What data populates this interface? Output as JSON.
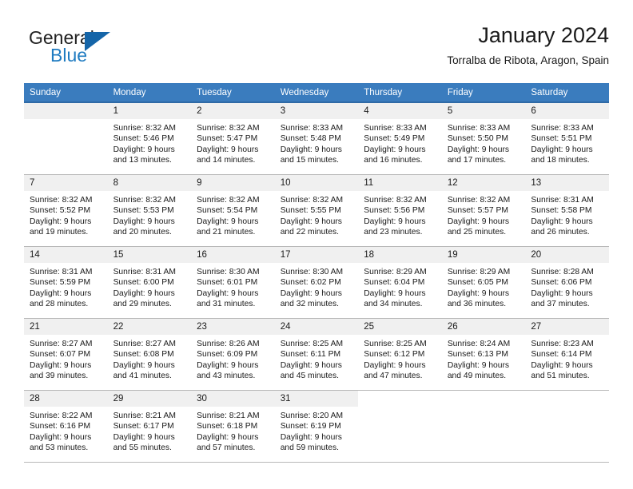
{
  "brand": {
    "line1": "General",
    "line2": "Blue",
    "triangle_color": "#1565a8",
    "blue_text_color": "#1f7bc1"
  },
  "header": {
    "title": "January 2024",
    "subtitle": "Torralba de Ribota, Aragon, Spain",
    "header_bg": "#3a7cbe",
    "daynum_bg": "#f0f0f0"
  },
  "calendar": {
    "weekday_headers": [
      "Sunday",
      "Monday",
      "Tuesday",
      "Wednesday",
      "Thursday",
      "Friday",
      "Saturday"
    ],
    "weeks": [
      [
        {
          "day": "",
          "lines": []
        },
        {
          "day": "1",
          "lines": [
            "Sunrise: 8:32 AM",
            "Sunset: 5:46 PM",
            "Daylight: 9 hours",
            "and 13 minutes."
          ]
        },
        {
          "day": "2",
          "lines": [
            "Sunrise: 8:32 AM",
            "Sunset: 5:47 PM",
            "Daylight: 9 hours",
            "and 14 minutes."
          ]
        },
        {
          "day": "3",
          "lines": [
            "Sunrise: 8:33 AM",
            "Sunset: 5:48 PM",
            "Daylight: 9 hours",
            "and 15 minutes."
          ]
        },
        {
          "day": "4",
          "lines": [
            "Sunrise: 8:33 AM",
            "Sunset: 5:49 PM",
            "Daylight: 9 hours",
            "and 16 minutes."
          ]
        },
        {
          "day": "5",
          "lines": [
            "Sunrise: 8:33 AM",
            "Sunset: 5:50 PM",
            "Daylight: 9 hours",
            "and 17 minutes."
          ]
        },
        {
          "day": "6",
          "lines": [
            "Sunrise: 8:33 AM",
            "Sunset: 5:51 PM",
            "Daylight: 9 hours",
            "and 18 minutes."
          ]
        }
      ],
      [
        {
          "day": "7",
          "lines": [
            "Sunrise: 8:32 AM",
            "Sunset: 5:52 PM",
            "Daylight: 9 hours",
            "and 19 minutes."
          ]
        },
        {
          "day": "8",
          "lines": [
            "Sunrise: 8:32 AM",
            "Sunset: 5:53 PM",
            "Daylight: 9 hours",
            "and 20 minutes."
          ]
        },
        {
          "day": "9",
          "lines": [
            "Sunrise: 8:32 AM",
            "Sunset: 5:54 PM",
            "Daylight: 9 hours",
            "and 21 minutes."
          ]
        },
        {
          "day": "10",
          "lines": [
            "Sunrise: 8:32 AM",
            "Sunset: 5:55 PM",
            "Daylight: 9 hours",
            "and 22 minutes."
          ]
        },
        {
          "day": "11",
          "lines": [
            "Sunrise: 8:32 AM",
            "Sunset: 5:56 PM",
            "Daylight: 9 hours",
            "and 23 minutes."
          ]
        },
        {
          "day": "12",
          "lines": [
            "Sunrise: 8:32 AM",
            "Sunset: 5:57 PM",
            "Daylight: 9 hours",
            "and 25 minutes."
          ]
        },
        {
          "day": "13",
          "lines": [
            "Sunrise: 8:31 AM",
            "Sunset: 5:58 PM",
            "Daylight: 9 hours",
            "and 26 minutes."
          ]
        }
      ],
      [
        {
          "day": "14",
          "lines": [
            "Sunrise: 8:31 AM",
            "Sunset: 5:59 PM",
            "Daylight: 9 hours",
            "and 28 minutes."
          ]
        },
        {
          "day": "15",
          "lines": [
            "Sunrise: 8:31 AM",
            "Sunset: 6:00 PM",
            "Daylight: 9 hours",
            "and 29 minutes."
          ]
        },
        {
          "day": "16",
          "lines": [
            "Sunrise: 8:30 AM",
            "Sunset: 6:01 PM",
            "Daylight: 9 hours",
            "and 31 minutes."
          ]
        },
        {
          "day": "17",
          "lines": [
            "Sunrise: 8:30 AM",
            "Sunset: 6:02 PM",
            "Daylight: 9 hours",
            "and 32 minutes."
          ]
        },
        {
          "day": "18",
          "lines": [
            "Sunrise: 8:29 AM",
            "Sunset: 6:04 PM",
            "Daylight: 9 hours",
            "and 34 minutes."
          ]
        },
        {
          "day": "19",
          "lines": [
            "Sunrise: 8:29 AM",
            "Sunset: 6:05 PM",
            "Daylight: 9 hours",
            "and 36 minutes."
          ]
        },
        {
          "day": "20",
          "lines": [
            "Sunrise: 8:28 AM",
            "Sunset: 6:06 PM",
            "Daylight: 9 hours",
            "and 37 minutes."
          ]
        }
      ],
      [
        {
          "day": "21",
          "lines": [
            "Sunrise: 8:27 AM",
            "Sunset: 6:07 PM",
            "Daylight: 9 hours",
            "and 39 minutes."
          ]
        },
        {
          "day": "22",
          "lines": [
            "Sunrise: 8:27 AM",
            "Sunset: 6:08 PM",
            "Daylight: 9 hours",
            "and 41 minutes."
          ]
        },
        {
          "day": "23",
          "lines": [
            "Sunrise: 8:26 AM",
            "Sunset: 6:09 PM",
            "Daylight: 9 hours",
            "and 43 minutes."
          ]
        },
        {
          "day": "24",
          "lines": [
            "Sunrise: 8:25 AM",
            "Sunset: 6:11 PM",
            "Daylight: 9 hours",
            "and 45 minutes."
          ]
        },
        {
          "day": "25",
          "lines": [
            "Sunrise: 8:25 AM",
            "Sunset: 6:12 PM",
            "Daylight: 9 hours",
            "and 47 minutes."
          ]
        },
        {
          "day": "26",
          "lines": [
            "Sunrise: 8:24 AM",
            "Sunset: 6:13 PM",
            "Daylight: 9 hours",
            "and 49 minutes."
          ]
        },
        {
          "day": "27",
          "lines": [
            "Sunrise: 8:23 AM",
            "Sunset: 6:14 PM",
            "Daylight: 9 hours",
            "and 51 minutes."
          ]
        }
      ],
      [
        {
          "day": "28",
          "lines": [
            "Sunrise: 8:22 AM",
            "Sunset: 6:16 PM",
            "Daylight: 9 hours",
            "and 53 minutes."
          ]
        },
        {
          "day": "29",
          "lines": [
            "Sunrise: 8:21 AM",
            "Sunset: 6:17 PM",
            "Daylight: 9 hours",
            "and 55 minutes."
          ]
        },
        {
          "day": "30",
          "lines": [
            "Sunrise: 8:21 AM",
            "Sunset: 6:18 PM",
            "Daylight: 9 hours",
            "and 57 minutes."
          ]
        },
        {
          "day": "31",
          "lines": [
            "Sunrise: 8:20 AM",
            "Sunset: 6:19 PM",
            "Daylight: 9 hours",
            "and 59 minutes."
          ]
        },
        {
          "day": "",
          "lines": []
        },
        {
          "day": "",
          "lines": []
        },
        {
          "day": "",
          "lines": []
        }
      ]
    ]
  }
}
